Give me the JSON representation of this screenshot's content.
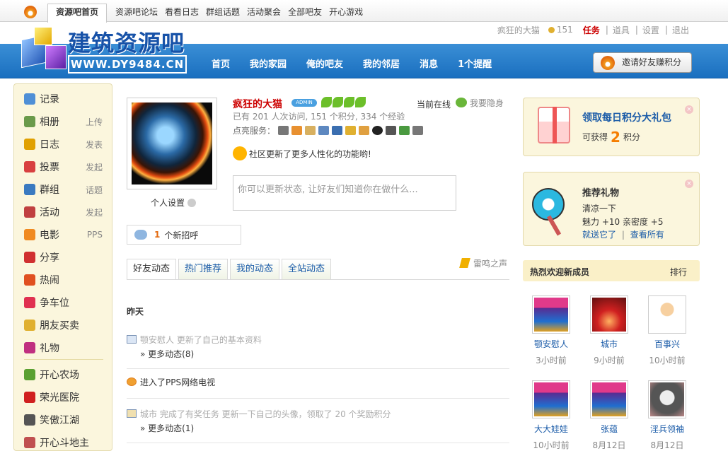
{
  "topbar": {
    "tab_label": "资源吧首页",
    "links": [
      "资源吧论坛",
      "看看日志",
      "群组话题",
      "活动聚会",
      "全部吧友",
      "开心游戏"
    ]
  },
  "userbar": {
    "username": "疯狂的大猫",
    "coins": "151",
    "task": "任务",
    "props": "道具",
    "settings": "设置",
    "logout": "退出"
  },
  "logo": {
    "title": "建筑资源吧",
    "url": "WWW.DY9484.CN"
  },
  "nav": [
    "首页",
    "我的家园",
    "俺的吧友",
    "我的邻居",
    "消息",
    "1个提醒"
  ],
  "invite_label": "邀请好友赚积分",
  "sidebar": {
    "items": [
      {
        "label": "记录",
        "extra": "",
        "icon": "speech-bubble-icon",
        "color": "#4f8fd6"
      },
      {
        "label": "相册",
        "extra": "上传",
        "icon": "photo-icon",
        "color": "#6a9a4a"
      },
      {
        "label": "日志",
        "extra": "发表",
        "icon": "notebook-icon",
        "color": "#e0a000"
      },
      {
        "label": "投票",
        "extra": "发起",
        "icon": "bar-chart-icon",
        "color": "#d84040"
      },
      {
        "label": "群组",
        "extra": "话题",
        "icon": "group-icon",
        "color": "#3a7ac0"
      },
      {
        "label": "活动",
        "extra": "发起",
        "icon": "calendar-icon",
        "color": "#c04040"
      },
      {
        "label": "电影",
        "extra": "PPS",
        "icon": "movie-icon",
        "color": "#f08a20"
      },
      {
        "label": "分享",
        "extra": "",
        "icon": "heart-icon",
        "color": "#d03030"
      },
      {
        "label": "热闹",
        "extra": "",
        "icon": "fire-icon",
        "color": "#e05020"
      },
      {
        "label": "争车位",
        "extra": "",
        "icon": "parking-icon",
        "color": "#e03050"
      },
      {
        "label": "朋友买卖",
        "extra": "",
        "icon": "coins-icon",
        "color": "#e0b030"
      },
      {
        "label": "礼物",
        "extra": "",
        "icon": "gift-icon",
        "color": "#c03080"
      },
      {
        "label": "开心农场",
        "extra": "",
        "icon": "sprout-icon",
        "color": "#5aa030"
      },
      {
        "label": "荣光医院",
        "extra": "",
        "icon": "red-cross-icon",
        "color": "#d02020"
      },
      {
        "label": "笑傲江湖",
        "extra": "",
        "icon": "sword-icon",
        "color": "#555555"
      },
      {
        "label": "开心斗地主",
        "extra": "",
        "icon": "cards-icon",
        "color": "#c05050"
      }
    ]
  },
  "profile": {
    "name": "疯狂的大猫",
    "badge": "ADMIN",
    "online": "当前在线",
    "hide": "我要隐身",
    "stats": "已有 201 人次访问, 151 个积分, 334 个经验",
    "services_label": "点亮服务：",
    "notice": "社区更新了更多人性化的功能哟!",
    "status_placeholder": "你可以更新状态, 让好友们知道你在做什么...",
    "settings_label": "个人设置",
    "greet_count": "1",
    "greet_label": "个新招呼"
  },
  "tabs": [
    "好友动态",
    "热门推荐",
    "我的动态",
    "全站动态"
  ],
  "voice_label": "雷鸣之声",
  "feed": {
    "day": "昨天",
    "items": [
      {
        "line1": "颚安慰人 更新了自己的基本资料",
        "line2": "» 更多动态(8)"
      },
      {
        "line1": "进入了PPS网络电视",
        "line2": ""
      },
      {
        "line1": "城市 完成了有奖任务 更新一下自己的头像，领取了 20 个奖励积分",
        "line2": "» 更多动态(1)"
      }
    ]
  },
  "daily": {
    "title": "领取每日积分大礼包",
    "prefix": "可获得",
    "amount": "2",
    "suffix": "积分"
  },
  "gift": {
    "title": "推荐礼物",
    "name": "清凉一下",
    "effects": "魅力 +10  亲密度 +5",
    "send": "就送它了",
    "sep": "|",
    "all": "查看所有"
  },
  "hot": {
    "title": "热烈欢迎新成员",
    "rank": "排行",
    "members": [
      {
        "name": "颚安慰人",
        "time": "3小时前"
      },
      {
        "name": "城市",
        "time": "9小时前"
      },
      {
        "name": "百事兴",
        "time": "10小时前"
      },
      {
        "name": "大大娃娃",
        "time": "10小时前"
      },
      {
        "name": "张蕴",
        "time": "8月12日"
      },
      {
        "name": "淫兵领袖",
        "time": "8月12日"
      }
    ]
  }
}
